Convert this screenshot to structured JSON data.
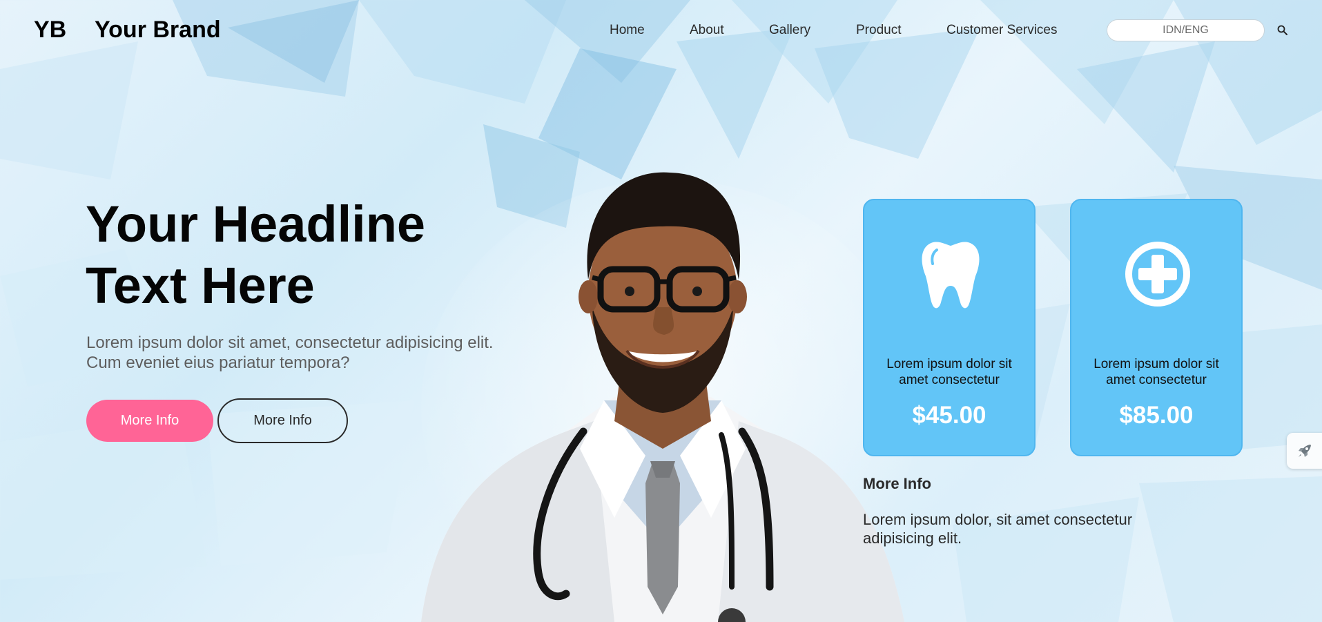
{
  "header": {
    "brand_mark": "YB",
    "brand_name": "Your Brand",
    "nav": [
      "Home",
      "About",
      "Gallery",
      "Product",
      "Customer Services"
    ],
    "language_toggle": "IDN/ENG",
    "search_icon": "search-icon"
  },
  "hero": {
    "headline_line1": "Your Headline",
    "headline_line2": "Text Here",
    "subtext_line1": "Lorem ipsum dolor sit amet, consectetur adipisicing elit.",
    "subtext_line2": "Cum eveniet eius pariatur tempora?",
    "primary_button": "More Info",
    "secondary_button": "More Info",
    "image": "doctor-portrait"
  },
  "cards": [
    {
      "icon": "tooth-icon",
      "line1": "Lorem ipsum dolor sit",
      "line2": "amet consectetur",
      "price": "$45.00"
    },
    {
      "icon": "medical-plus-icon",
      "line1": "Lorem ipsum dolor sit",
      "line2": "amet consectetur",
      "price": "$85.00"
    }
  ],
  "more_info": {
    "title": "More Info",
    "text_line1": "Lorem ipsum dolor, sit amet consectetur",
    "text_line2": "adipisicing elit."
  },
  "side_widget": {
    "icon": "rocket-icon"
  },
  "colors": {
    "accent_pink": "#ff6496",
    "card_blue": "#62c5f7",
    "text_dark": "#050505"
  }
}
